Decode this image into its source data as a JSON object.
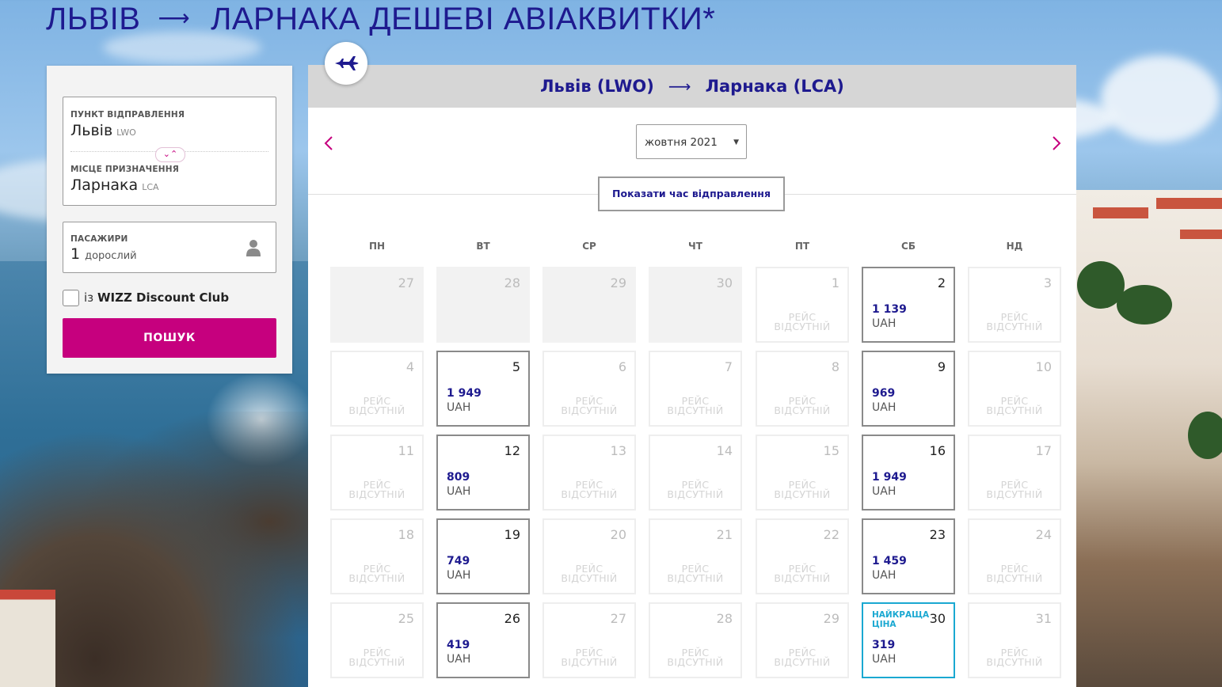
{
  "page_title": {
    "origin": "ЛЬВІВ",
    "arrow": "⟶",
    "rest": "ЛАРНАКА ДЕШЕВІ АВІАКВИТКИ*"
  },
  "search_panel": {
    "origin_label": "ПУНКТ ВІДПРАВЛЕННЯ",
    "origin_city": "Львів",
    "origin_code": "LWO",
    "destination_label": "МІСЦЕ ПРИЗНАЧЕННЯ",
    "destination_city": "Ларнака",
    "destination_code": "LCA",
    "swap_glyph": "⌄⌃",
    "passengers_label": "ПАСАЖИРИ",
    "passengers_count": "1",
    "passengers_word": "дорослий",
    "wdc_prefix": "із",
    "wdc_name": "WIZZ Discount Club",
    "search_button": "ПОШУК"
  },
  "calendar": {
    "route_from": "Львів (LWO)",
    "route_arrow": "⟶",
    "route_to": "Ларнака (LCA)",
    "month": "жовтня 2021",
    "month_caret": "▼",
    "show_times_button": "Показати час відправлення",
    "weekdays": [
      "ПН",
      "ВТ",
      "СР",
      "ЧТ",
      "ПТ",
      "СБ",
      "НД"
    ],
    "no_flight_line1": "РЕЙС",
    "no_flight_line2": "ВІДСУТНІЙ",
    "best_price_label": "НАЙКРАЩА ЦІНА",
    "weeks": [
      [
        {
          "day": "27",
          "state": "past"
        },
        {
          "day": "28",
          "state": "past"
        },
        {
          "day": "29",
          "state": "past"
        },
        {
          "day": "30",
          "state": "past"
        },
        {
          "day": "1",
          "state": "none"
        },
        {
          "day": "2",
          "state": "price",
          "price": "1 139",
          "currency": "UAH"
        },
        {
          "day": "3",
          "state": "none"
        }
      ],
      [
        {
          "day": "4",
          "state": "none"
        },
        {
          "day": "5",
          "state": "price",
          "price": "1 949",
          "currency": "UAH"
        },
        {
          "day": "6",
          "state": "none"
        },
        {
          "day": "7",
          "state": "none"
        },
        {
          "day": "8",
          "state": "none"
        },
        {
          "day": "9",
          "state": "price",
          "price": "969",
          "currency": "UAH"
        },
        {
          "day": "10",
          "state": "none"
        }
      ],
      [
        {
          "day": "11",
          "state": "none"
        },
        {
          "day": "12",
          "state": "price",
          "price": "809",
          "currency": "UAH"
        },
        {
          "day": "13",
          "state": "none"
        },
        {
          "day": "14",
          "state": "none"
        },
        {
          "day": "15",
          "state": "none"
        },
        {
          "day": "16",
          "state": "price",
          "price": "1 949",
          "currency": "UAH"
        },
        {
          "day": "17",
          "state": "none"
        }
      ],
      [
        {
          "day": "18",
          "state": "none"
        },
        {
          "day": "19",
          "state": "price",
          "price": "749",
          "currency": "UAH"
        },
        {
          "day": "20",
          "state": "none"
        },
        {
          "day": "21",
          "state": "none"
        },
        {
          "day": "22",
          "state": "none"
        },
        {
          "day": "23",
          "state": "price",
          "price": "1 459",
          "currency": "UAH"
        },
        {
          "day": "24",
          "state": "none"
        }
      ],
      [
        {
          "day": "25",
          "state": "none"
        },
        {
          "day": "26",
          "state": "price",
          "price": "419",
          "currency": "UAH"
        },
        {
          "day": "27",
          "state": "none"
        },
        {
          "day": "28",
          "state": "none"
        },
        {
          "day": "29",
          "state": "none"
        },
        {
          "day": "30",
          "state": "best",
          "price": "319",
          "currency": "UAH"
        },
        {
          "day": "31",
          "state": "none"
        }
      ]
    ]
  },
  "colors": {
    "brand_navy": "#1e1a8f",
    "brand_magenta": "#c6007e",
    "best_price_cyan": "#1aa8d1"
  },
  "icons": [
    "airplane-icon",
    "chevron-left-icon",
    "chevron-right-icon",
    "person-icon",
    "swap-icon"
  ]
}
